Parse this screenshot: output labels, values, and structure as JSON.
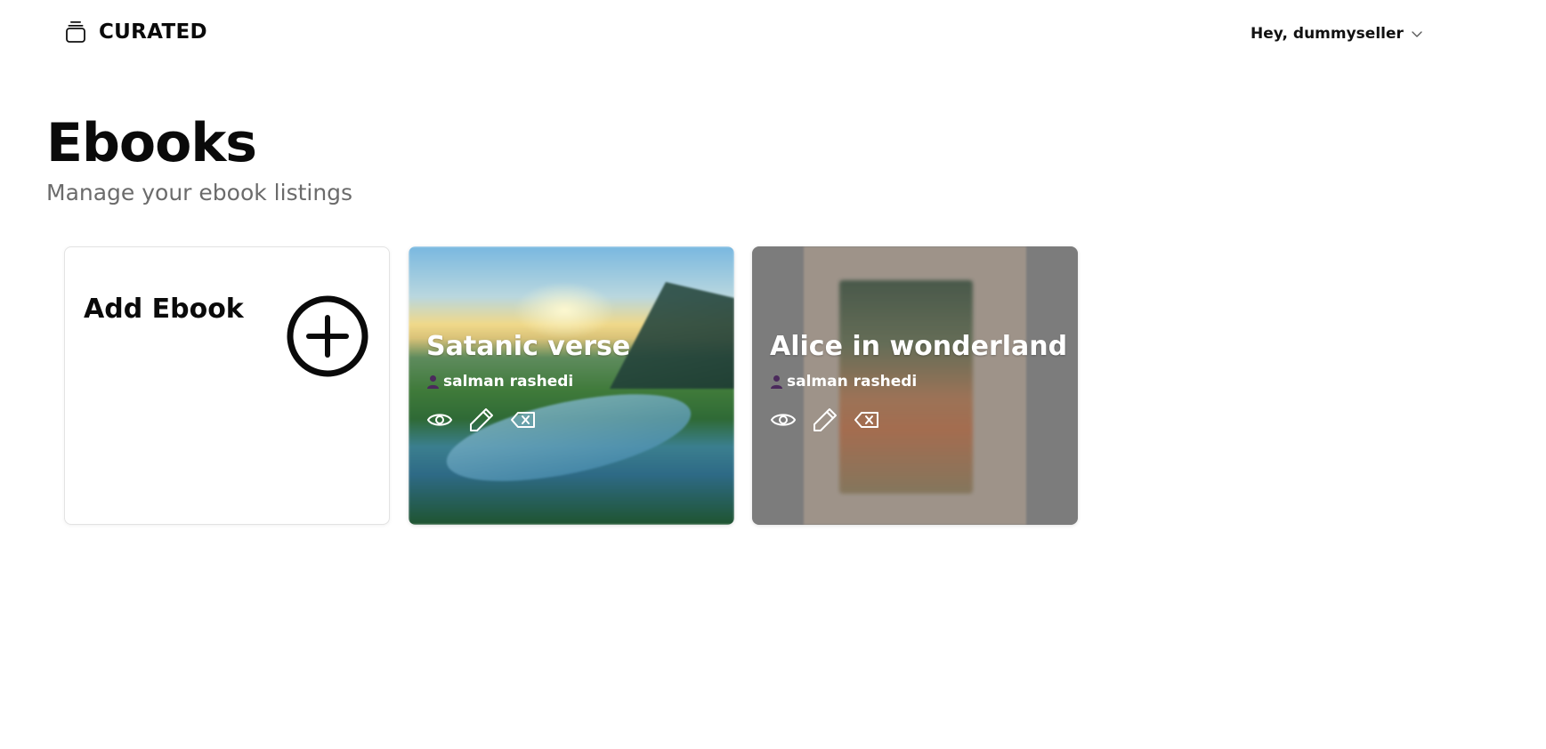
{
  "header": {
    "brand": "CURATED",
    "brand_icon": "stack-icon",
    "greeting": "Hey, dummyseller",
    "menu_icon": "chevron-down-icon"
  },
  "page": {
    "title": "Ebooks",
    "subtitle": "Manage your ebook listings"
  },
  "add_card": {
    "label": "Add Ebook",
    "icon": "plus-circle-icon"
  },
  "books": [
    {
      "title": "Satanic verse",
      "author": "salman rashedi",
      "actions": [
        "view-icon",
        "edit-icon",
        "delete-icon"
      ]
    },
    {
      "title": "Alice in wonderland",
      "author": "salman rashedi",
      "actions": [
        "view-icon",
        "edit-icon",
        "delete-icon"
      ]
    }
  ],
  "colors": {
    "text": "#0a0a0a",
    "subtitle": "#6b6b6b",
    "author_icon": "#4b2a5c"
  }
}
